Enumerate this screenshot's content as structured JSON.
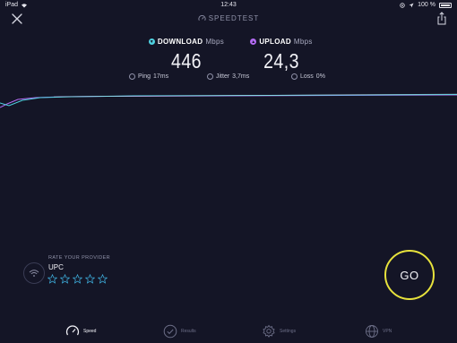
{
  "status_bar": {
    "device": "iPad",
    "time": "12:43",
    "battery": "100 %"
  },
  "header": {
    "brand": "SPEEDTEST"
  },
  "download": {
    "label": "DOWNLOAD",
    "unit": "Mbps",
    "value": "446",
    "color": "#4fd1e0"
  },
  "upload": {
    "label": "UPLOAD",
    "unit": "Mbps",
    "value": "24,3",
    "color": "#b36bf2"
  },
  "stats": {
    "ping_label": "Ping",
    "ping_value": "17ms",
    "jitter_label": "Jitter",
    "jitter_value": "3,7ms",
    "loss_label": "Loss",
    "loss_value": "0%"
  },
  "provider": {
    "rate_label": "RATE YOUR PROVIDER",
    "name": "UPC",
    "star_count": 5
  },
  "go_button": {
    "label": "GO",
    "color": "#e7e23c"
  },
  "nav": [
    {
      "label": "Speed",
      "icon": "speedometer-icon",
      "active": true
    },
    {
      "label": "Results",
      "icon": "checkmark-circle-icon",
      "active": false
    },
    {
      "label": "Settings",
      "icon": "gear-icon",
      "active": false
    },
    {
      "label": "VPN",
      "icon": "globe-icon",
      "active": false
    }
  ]
}
